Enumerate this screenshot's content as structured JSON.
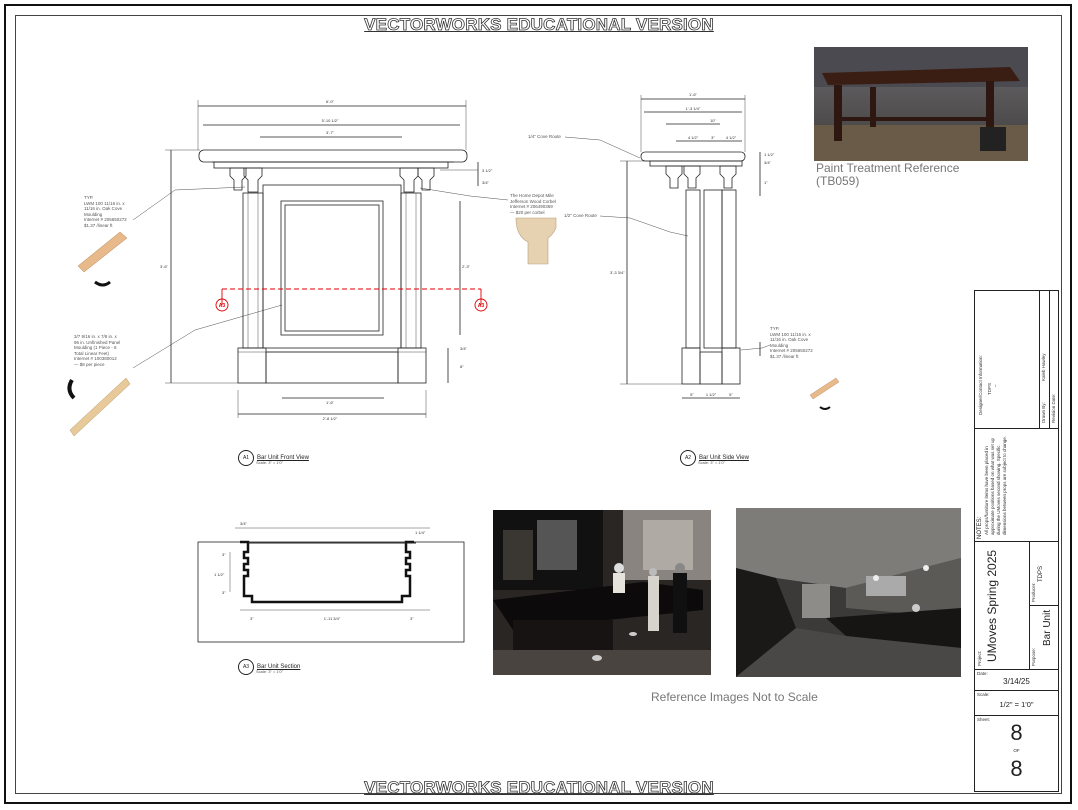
{
  "watermark": "VECTORWORKS EDUCATIONAL VERSION",
  "front_view": {
    "bubble": "A1",
    "title": "Bar Unit Front View",
    "scale": "Scale: 3\" = 1'0\"",
    "dims": {
      "overall_width": "6'-0\"",
      "top_width": "5'-10 1/2\"",
      "upper_width": "3'-7\"",
      "height": "3'-6\"",
      "panel_height": "2'-3\"",
      "base_width": "1'-6\"",
      "bottom_width": "2'-8 1/2\"",
      "crown_a": "3 1/2\"",
      "crown_b": "3/4\"",
      "base_a": "3/4\"",
      "base_b": "8\""
    },
    "section_mark": "A3"
  },
  "side_view": {
    "bubble": "A2",
    "title": "Bar Unit Side View",
    "scale": "Scale: 3\" = 1'0\"",
    "dims": {
      "overall": "1'-6\"",
      "top": "1'-3 1/4\"",
      "inner": "10\"",
      "seg_a": "4 1/2\"",
      "seg_b": "3\"",
      "seg_c": "4 1/2\"",
      "height": "3'-3 3/4\"",
      "cap_a": "1 1/2\"",
      "cap_b": "3/4\"",
      "cap_c": "1\"",
      "base_a": "5\"",
      "base_b": "1 1/2\"",
      "base_c": "5\""
    },
    "cove_note_a": "1/4\" Cove Route",
    "cove_note_b": "1/2\" Cove Route"
  },
  "section_view": {
    "bubble": "A3",
    "title": "Bar Unit Section",
    "scale": "Scale: 3\" = 1'0\"",
    "dims": {
      "a": "3/4\"",
      "b": "1 1/4\"",
      "c": "3\"",
      "d": "1 1/2\"",
      "e": "3\"",
      "f": "3\"",
      "g": "1'-11 3/4\"",
      "h": "3\""
    }
  },
  "notes_left": {
    "crown": [
      "TYP.",
      "LWM 100 11/16 in. x",
      "11/16 in. Oak Cove",
      "Moulding",
      "Internet # 205650272",
      "$1.37 /linear ft"
    ],
    "panel": [
      "3/7 9/16 in. x 7/8 in. x",
      "96 in. Unfinished Panel",
      "Moulding (1 Piece - 8",
      "Total Linear Feet)",
      "",
      "Internet # 100380012",
      "— $8 per piece"
    ],
    "corbel": [
      "The Home Depot Mile",
      "Jefferson Wood Corbel",
      "Internet # 206490369",
      "— $20 per corbel"
    ],
    "side_crown": [
      "TYP.",
      "LWM 100 11/16 in. x",
      "11/16 in. Oak Cove",
      "Moulding",
      "Internet # 205650272",
      "$1.37 /linear ft"
    ]
  },
  "captions": {
    "paint_ref": "Paint Treatment Reference",
    "paint_ref_id": "(TB059)",
    "ref_images": "Reference Images Not to Scale"
  },
  "title_block": {
    "designer_label": "Designer/Contact Information:",
    "designer_value": "TDPS",
    "designer_dash": "–",
    "drawn_by_label": "Drawn By:",
    "drawn_by_value": "Kaleb Hawley",
    "revision_label": "Revision Date:",
    "notes_label": "NOTES:",
    "notes_text": "All props/furniture items have been placed in approximate positions based on what was set up during the UMoves second showing. Specific dimensions between props are subject to change.",
    "project_label": "Project:",
    "project_value": "UMoves Spring 2025",
    "producer_label": "Producer:",
    "producer_value": "TDPS",
    "purpose_label": "Purpose:",
    "purpose_value": "Bar Unit",
    "date_label": "Date:",
    "date_value": "3/14/25",
    "scale_label": "Scale:",
    "scale_value": "1/2\" = 1'0\"",
    "sheet_label": "Sheet:",
    "sheet_num": "8",
    "sheet_of": "OF",
    "sheet_total": "8"
  },
  "colors": {
    "section_line": "#e00000",
    "line": "#222222",
    "caption": "#777777"
  }
}
